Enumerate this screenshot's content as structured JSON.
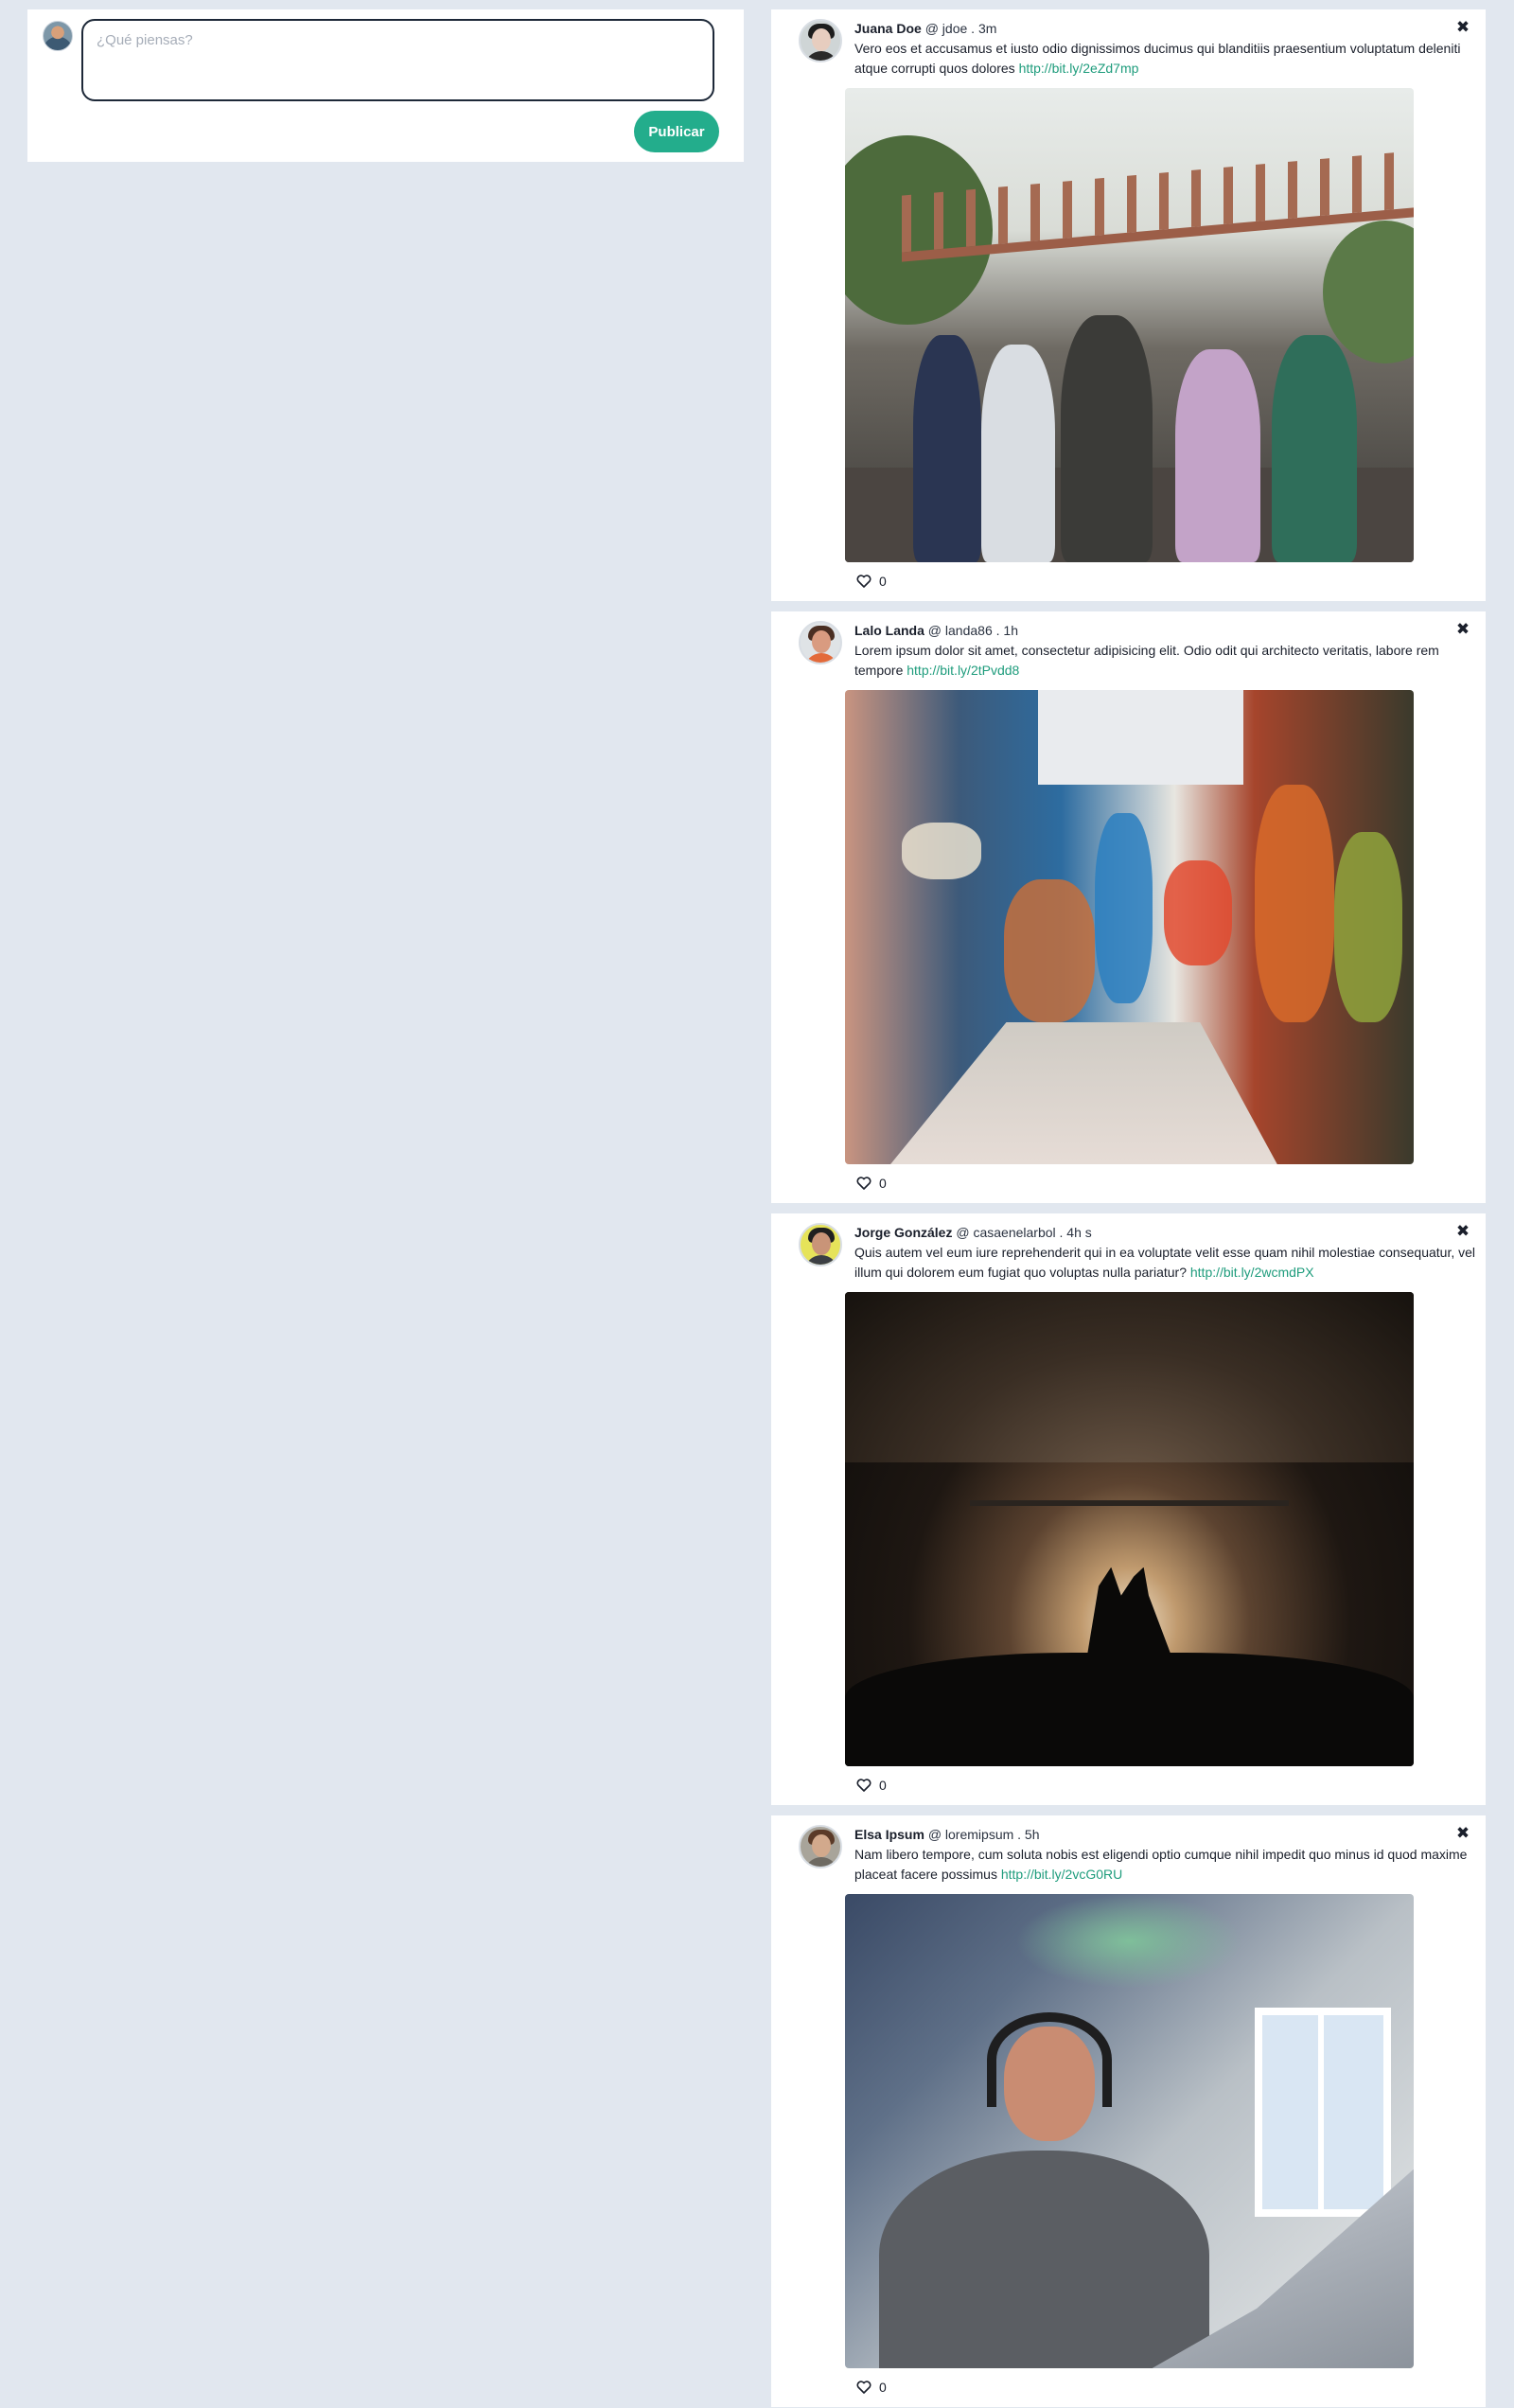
{
  "composer": {
    "placeholder": "¿Qué piensas?",
    "publish_label": "Publicar"
  },
  "posts": [
    {
      "name": "Juana Doe",
      "handle": "@ jdoe",
      "time": ". 3m",
      "text": "Vero eos et accusamus et iusto odio dignissimos ducimus qui blanditiis praesentium voluptatum deleniti atque corrupti quos dolores",
      "link": "http://bit.ly/2eZd7mp",
      "likes": "0",
      "close": "✖"
    },
    {
      "name": "Lalo Landa",
      "handle": "@ landa86",
      "time": ". 1h",
      "text": "Lorem ipsum dolor sit amet, consectetur adipisicing elit. Odio odit qui architecto veritatis, labore rem tempore",
      "link": "http://bit.ly/2tPvdd8",
      "likes": "0",
      "close": "✖"
    },
    {
      "name": "Jorge González",
      "handle": "@ casaenelarbol",
      "time": ". 4h s",
      "text": "Quis autem vel eum iure reprehenderit qui in ea voluptate velit esse quam nihil molestiae consequatur, vel illum qui dolorem eum fugiat quo voluptas nulla pariatur?",
      "link": "http://bit.ly/2wcmdPX",
      "likes": "0",
      "close": "✖"
    },
    {
      "name": "Elsa Ipsum",
      "handle": "@ loremipsum",
      "time": ". 5h",
      "text": "Nam libero tempore, cum soluta nobis est eligendi optio cumque nihil impedit quo minus id quod maxime placeat facere possimus",
      "link": "http://bit.ly/2vcG0RU",
      "likes": "0",
      "close": "✖"
    }
  ],
  "colors": {
    "background": "#e1e7ef",
    "accent": "#23ad8c",
    "link": "#1e9c7c"
  },
  "icons": {
    "like": "heart-outline-icon",
    "close": "close-x-icon"
  }
}
